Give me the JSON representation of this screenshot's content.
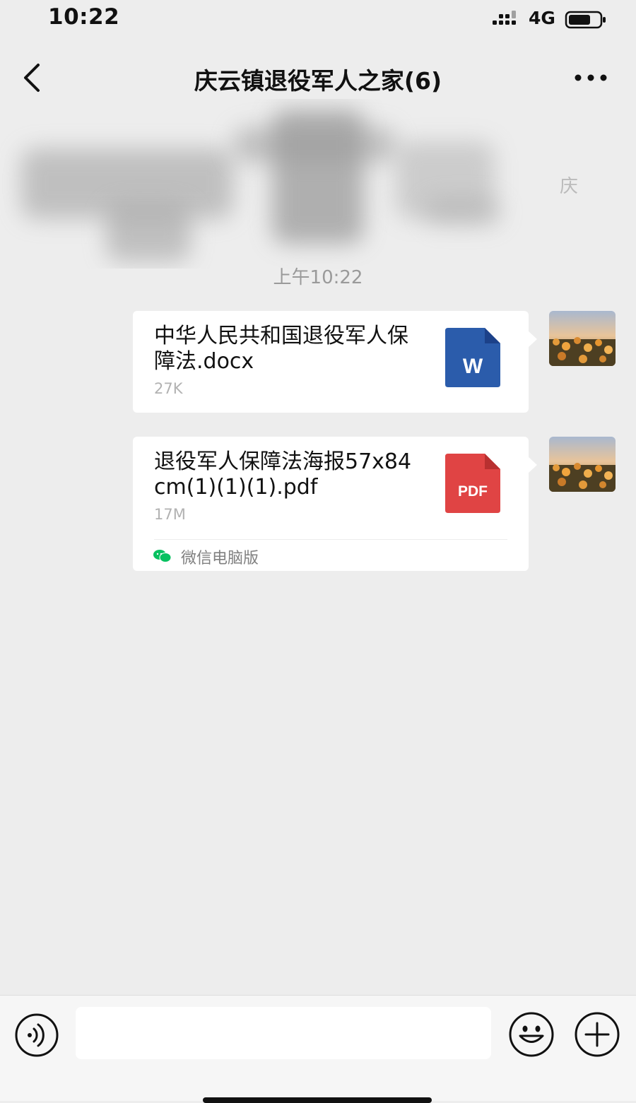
{
  "status_bar": {
    "time": "10:22",
    "network": "4G",
    "signal_icon": "signal-bars-icon",
    "battery_icon": "battery-icon"
  },
  "nav": {
    "back_icon": "chevron-left-icon",
    "title": "庆云镇退役军人之家(6)",
    "more_icon": "more-dots-icon"
  },
  "redacted": {
    "visible_fragment": "庆"
  },
  "chat": {
    "timestamp": "上午10:22",
    "messages": [
      {
        "file_name": "中华人民共和国退役军人保障法.docx",
        "file_size": "27K",
        "file_type": "word",
        "icon_label": "W",
        "icon_color": "#2b5cab"
      },
      {
        "file_name": "退役军人保障法海报57x84cm(1)(1)(1).pdf",
        "file_size": "17M",
        "file_type": "pdf",
        "icon_label": "PDF",
        "icon_color": "#e04444",
        "source_label": "微信电脑版",
        "source_icon": "wechat-icon"
      }
    ]
  },
  "input_bar": {
    "voice_icon": "voice-icon",
    "emoji_icon": "emoji-smile-icon",
    "plus_icon": "plus-circle-icon",
    "input_value": ""
  },
  "colors": {
    "background": "#ededed",
    "bubble": "#ffffff",
    "word_blue": "#2b5cab",
    "pdf_red": "#e04444",
    "wechat_green": "#07c160"
  }
}
